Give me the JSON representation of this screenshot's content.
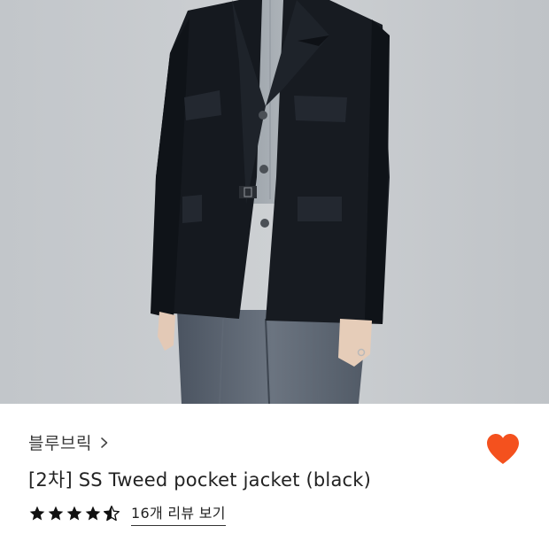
{
  "product": {
    "brand": "블루브릭",
    "title": "[2차] SS Tweed pocket jacket (black)",
    "rating": 4.5,
    "rating_max": 5,
    "review_link": "16개 리뷰 보기"
  },
  "icons": {
    "brand_chevron": "chevron-right-icon",
    "wishlist": "heart-icon",
    "rating_star": "star-icon"
  },
  "colors": {
    "heart": "#f4511e",
    "star": "#111111",
    "text": "#222222"
  }
}
